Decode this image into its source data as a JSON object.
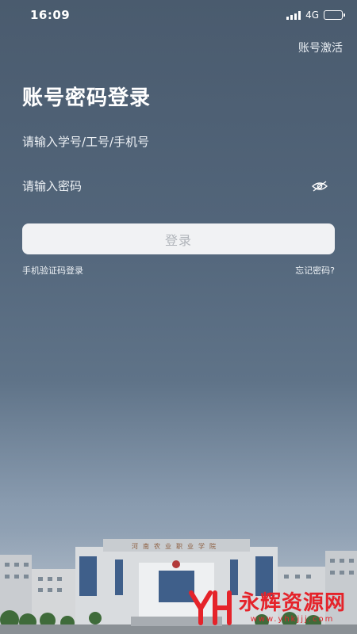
{
  "statusbar": {
    "time": "16:09",
    "network": "4G"
  },
  "header": {
    "activate_label": "账号激活"
  },
  "login": {
    "title": "账号密码登录",
    "account_placeholder": "请输入学号/工号/手机号",
    "password_placeholder": "请输入密码",
    "submit_label": "登录",
    "sms_login_label": "手机验证码登录",
    "forgot_label": "忘记密码?"
  },
  "campus": {
    "sign_text": "河南农业职业学院"
  },
  "watermark": {
    "title": "永辉资源网",
    "url": "www.yhkjjj.com"
  }
}
